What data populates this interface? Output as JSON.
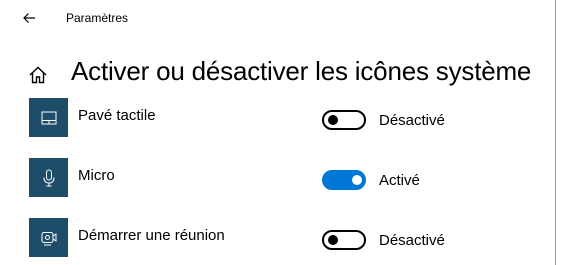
{
  "window": {
    "title": "Paramètres"
  },
  "page": {
    "title": "Activer ou désactiver les icônes système"
  },
  "icons": {
    "back": "back-arrow-icon",
    "home": "home-icon"
  },
  "colors": {
    "tile": "#1e4d6a",
    "accent": "#0078d7"
  },
  "items": [
    {
      "label": "Pavé tactile",
      "icon": "touchpad-icon",
      "on": false,
      "state": "Désactivé"
    },
    {
      "label": "Micro",
      "icon": "microphone-icon",
      "on": true,
      "state": "Activé"
    },
    {
      "label": "Démarrer une réunion",
      "icon": "meet-now-icon",
      "on": false,
      "state": "Désactivé"
    }
  ]
}
